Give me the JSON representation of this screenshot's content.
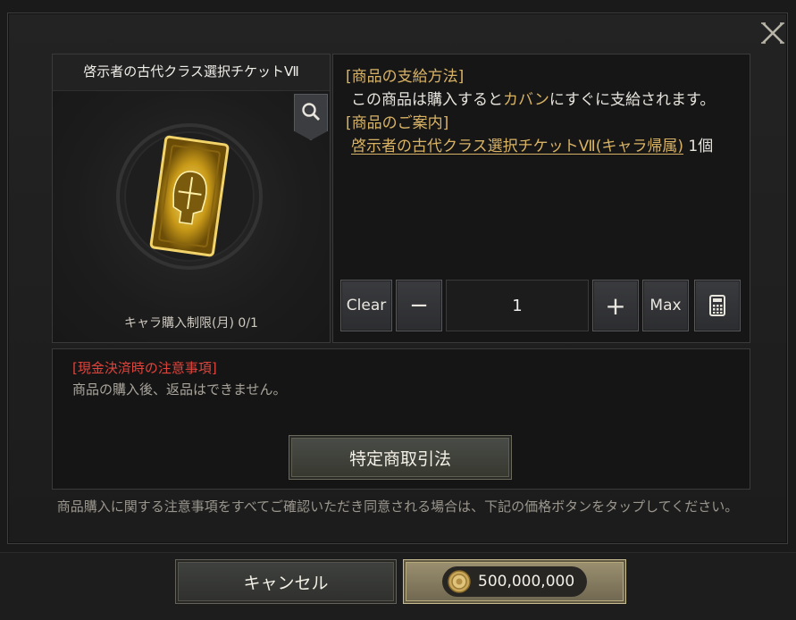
{
  "item": {
    "name": "啓示者の古代クラス選択チケットⅦ",
    "limit_text": "キャラ購入制限(月) 0/1"
  },
  "info": {
    "supply_heading": "[商品の支給方法]",
    "supply_pre": "この商品は購入すると",
    "supply_highlight": "カバン",
    "supply_post": "にすぐに支給されます。",
    "guide_heading": "[商品のご案内]",
    "guide_link": "啓示者の古代クラス選択チケットⅦ(キャラ帰属)",
    "guide_count": " 1個"
  },
  "quantity": {
    "clear_label": "Clear",
    "minus_label": "−",
    "value": "1",
    "plus_label": "+",
    "max_label": "Max"
  },
  "notice": {
    "title": "[現金決済時の注意事項]",
    "body": "商品の購入後、返品はできません。",
    "law_button": "特定商取引法"
  },
  "agreement_text": "商品購入に関する注意事項をすべてご確認いただき同意される場合は、下記の価格ボタンをタップしてください。",
  "footer": {
    "cancel_label": "キャンセル",
    "price": "500,000,000"
  },
  "colors": {
    "accent_gold": "#d9b365",
    "notice_red": "#e0443c"
  },
  "icons": {
    "close": "close-icon",
    "zoom": "magnifier-icon",
    "calculator": "calculator-icon",
    "coin": "coin-icon"
  }
}
